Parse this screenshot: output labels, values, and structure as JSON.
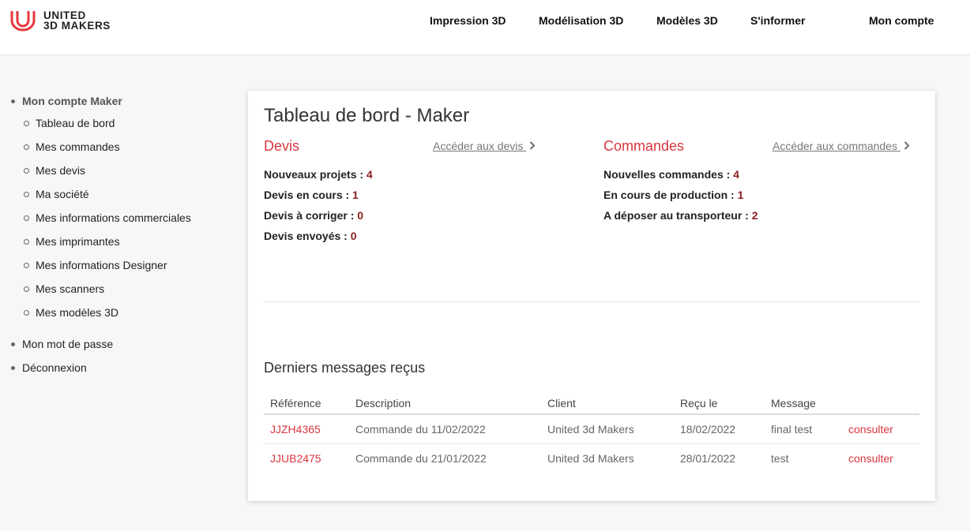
{
  "header": {
    "logo_line1": "UNITED",
    "logo_line2": "3D MAKERS",
    "nav": [
      "Impression 3D",
      "Modélisation 3D",
      "Modèles 3D",
      "S'informer"
    ],
    "account": "Mon compte"
  },
  "sidebar": {
    "section_title": "Mon compte Maker",
    "items": [
      "Tableau de bord",
      "Mes commandes",
      "Mes devis",
      "Ma société",
      "Mes informations commerciales",
      "Mes imprimantes",
      "Mes informations Designer",
      "Mes scanners",
      "Mes modèles 3D"
    ],
    "password": "Mon mot de passe",
    "logout": "Déconnexion"
  },
  "dashboard": {
    "title": "Tableau de bord - Maker",
    "devis": {
      "title": "Devis",
      "link": "Accéder aux devis",
      "stats": [
        {
          "label": "Nouveaux projets : ",
          "value": "4"
        },
        {
          "label": "Devis en cours : ",
          "value": "1"
        },
        {
          "label": "Devis à corriger : ",
          "value": "0"
        },
        {
          "label": "Devis envoyés : ",
          "value": "0"
        }
      ]
    },
    "commandes": {
      "title": "Commandes",
      "link": "Accéder aux commandes",
      "stats": [
        {
          "label": "Nouvelles commandes : ",
          "value": "4"
        },
        {
          "label": "En cours de production : ",
          "value": "1"
        },
        {
          "label": "A déposer au transporteur : ",
          "value": "2"
        }
      ]
    },
    "messages": {
      "title": "Derniers messages reçus",
      "columns": [
        "Référence",
        "Description",
        "Client",
        "Reçu le",
        "Message"
      ],
      "rows": [
        {
          "ref": "JJZH4365",
          "desc": "Commande du 11/02/2022",
          "client": "United 3d Makers",
          "date": "18/02/2022",
          "message": "final test",
          "action": "consulter"
        },
        {
          "ref": "JJUB2475",
          "desc": "Commande du 21/01/2022",
          "client": "United 3d Makers",
          "date": "28/01/2022",
          "message": "test",
          "action": "consulter"
        }
      ]
    }
  },
  "colors": {
    "accent": "#d9363e",
    "value": "#8a1f23"
  }
}
